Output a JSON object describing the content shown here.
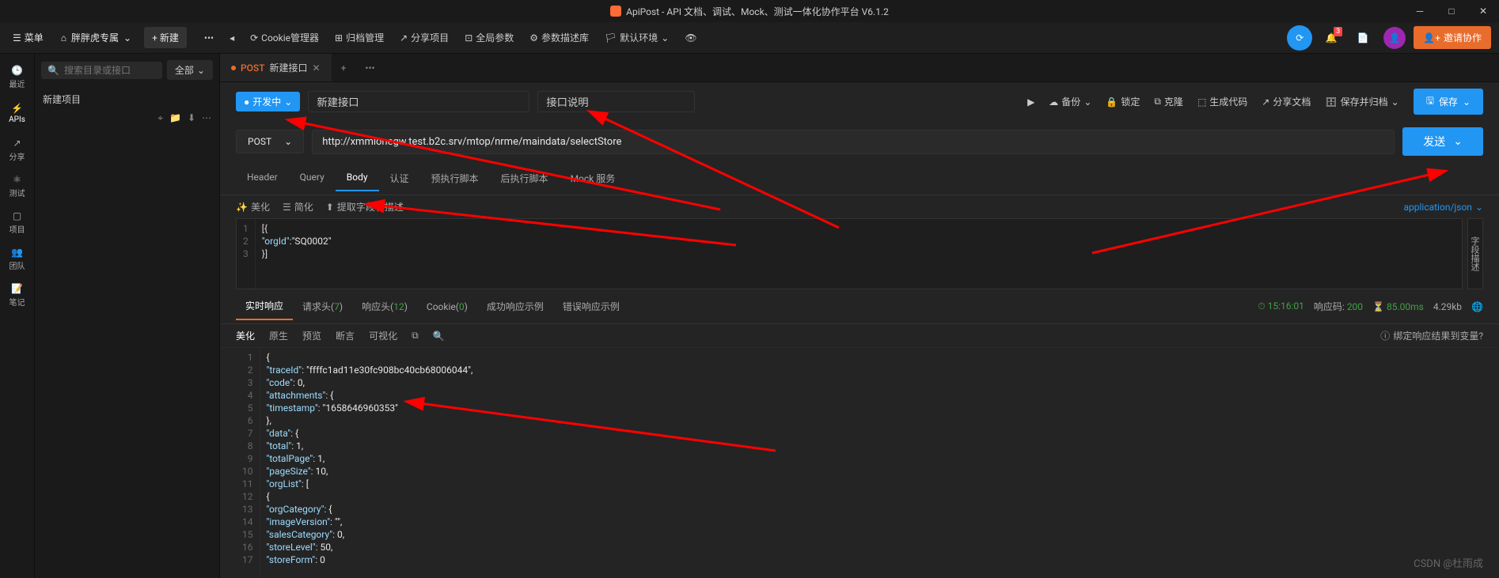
{
  "app": {
    "title": "ApiPost - API 文档、调试、Mock、测试一体化协作平台 V6.1.2"
  },
  "topbar": {
    "menu": "菜单",
    "team": "胖胖虎专属",
    "new_btn": "+ 新建",
    "cookie_mgr": "Cookie管理器",
    "archive": "归档管理",
    "share_project": "分享项目",
    "global_params": "全局参数",
    "param_desc_lib": "参数描述库",
    "default_env": "默认环境",
    "invite": "邀请协作",
    "notif_badge": "3"
  },
  "rail": [
    {
      "label": "最近",
      "icon": "clock"
    },
    {
      "label": "APIs",
      "icon": "api"
    },
    {
      "label": "分享",
      "icon": "share"
    },
    {
      "label": "测试",
      "icon": "test"
    },
    {
      "label": "项目",
      "icon": "project"
    },
    {
      "label": "团队",
      "icon": "team"
    },
    {
      "label": "笔记",
      "icon": "note"
    }
  ],
  "sidebar": {
    "search_placeholder": "搜索目录或接口",
    "filter": "全部",
    "project": "新建项目"
  },
  "tabs": {
    "active": {
      "method": "POST",
      "name": "新建接口"
    }
  },
  "api_header": {
    "status": "开发中",
    "name": "新建接口",
    "desc": "接口说明",
    "run": "",
    "backup": "备份",
    "lock": "锁定",
    "clone": "克隆",
    "gen_code": "生成代码",
    "share_doc": "分享文档",
    "save_archive": "保存并归档",
    "save": "保存"
  },
  "url_row": {
    "method": "POST",
    "url": "http://xmmionegw.test.b2c.srv/mtop/nrme/maindata/selectStore",
    "send": "发送"
  },
  "req_tabs": [
    "Header",
    "Query",
    "Body",
    "认证",
    "预执行脚本",
    "后执行脚本",
    "Mock 服务"
  ],
  "req_tab_active": 2,
  "body_tools": {
    "beautify": "美化",
    "simplify": "简化",
    "extract": "提取字段和描述",
    "content_type": "application/json",
    "side_label": "字段描述"
  },
  "request_body": [
    "[{",
    "    \"orgId\":\"SQ0002\"",
    "}]"
  ],
  "resp_tabs": {
    "realtime": "实时响应",
    "req_headers": "请求头",
    "req_headers_count": "7",
    "resp_headers": "响应头",
    "resp_headers_count": "12",
    "cookie": "Cookie",
    "cookie_count": "0",
    "success_example": "成功响应示例",
    "error_example": "错误响应示例"
  },
  "resp_meta": {
    "time": "15:16:01",
    "code_label": "响应码:",
    "code": "200",
    "duration": "85.00ms",
    "size": "4.29kb"
  },
  "resp_tools": [
    "美化",
    "原生",
    "预览",
    "断言",
    "可视化"
  ],
  "resp_tool_active": 0,
  "bind_hint": "绑定响应结果到变量?",
  "response_lines": [
    {
      "n": 1,
      "t": "{"
    },
    {
      "n": 2,
      "t": "    \"traceId\": \"ffffc1ad11e30fc908bc40cb68006044\","
    },
    {
      "n": 3,
      "t": "    \"code\": 0,"
    },
    {
      "n": 4,
      "t": "    \"attachments\": {"
    },
    {
      "n": 5,
      "t": "        \"timestamp\": \"1658646960353\""
    },
    {
      "n": 6,
      "t": "    },"
    },
    {
      "n": 7,
      "t": "    \"data\": {"
    },
    {
      "n": 8,
      "t": "        \"total\": 1,"
    },
    {
      "n": 9,
      "t": "        \"totalPage\": 1,"
    },
    {
      "n": 10,
      "t": "        \"pageSize\": 10,"
    },
    {
      "n": 11,
      "t": "        \"orgList\": ["
    },
    {
      "n": 12,
      "t": "            {"
    },
    {
      "n": 13,
      "t": "                \"orgCategory\": {"
    },
    {
      "n": 14,
      "t": "                    \"imageVersion\": \"\","
    },
    {
      "n": 15,
      "t": "                    \"salesCategory\": 0,"
    },
    {
      "n": 16,
      "t": "                    \"storeLevel\": 50,"
    },
    {
      "n": 17,
      "t": "                    \"storeForm\": 0"
    }
  ],
  "watermark": "CSDN @杜雨成"
}
